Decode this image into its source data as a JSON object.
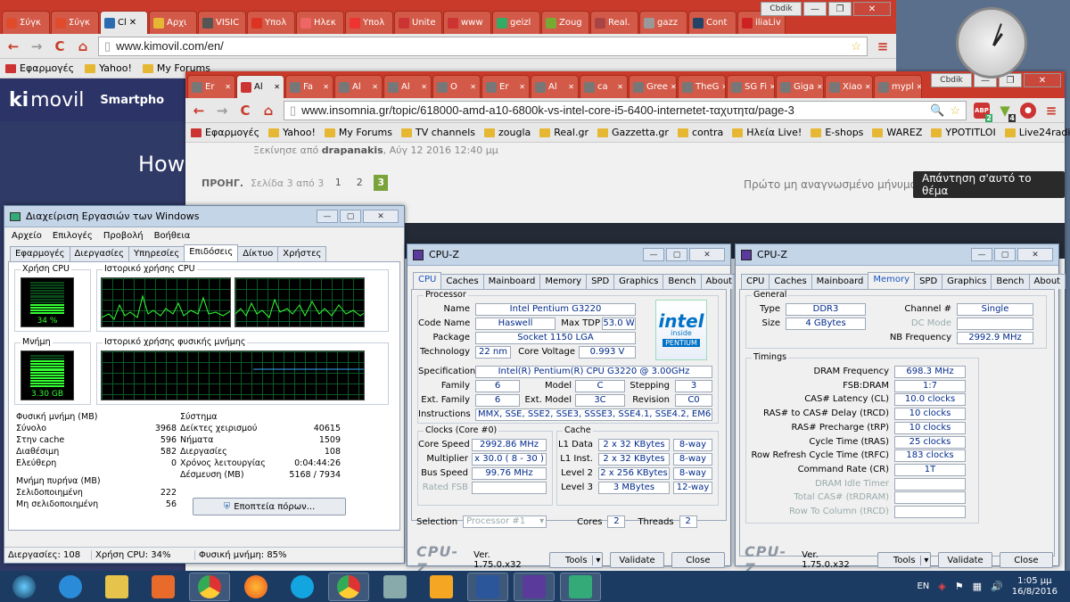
{
  "browser1": {
    "tabs": [
      {
        "label": "Σύγκ",
        "color": "#e04b2c"
      },
      {
        "label": "Σύγκ",
        "color": "#e04b2c"
      },
      {
        "label": "Cl",
        "color": "#2b6cb0",
        "active": true
      },
      {
        "label": "Αρχι",
        "color": "#e6b733"
      },
      {
        "label": "VISIC",
        "color": "#555"
      },
      {
        "label": "Υπολ",
        "color": "#d32"
      },
      {
        "label": "Ηλεκ",
        "color": "#e66"
      },
      {
        "label": "Υπολ",
        "color": "#e33"
      },
      {
        "label": "Unite",
        "color": "#c33"
      },
      {
        "label": "www",
        "color": "#c33"
      },
      {
        "label": "geizl",
        "color": "#3a6"
      },
      {
        "label": "Zoug",
        "color": "#7a3"
      },
      {
        "label": "Real.",
        "color": "#a44"
      },
      {
        "label": "gazz",
        "color": "#999"
      },
      {
        "label": "Cont",
        "color": "#246"
      },
      {
        "label": "iliaLiv",
        "color": "#c22"
      }
    ],
    "url": "www.kimovil.com/en/",
    "user": "Cbdik",
    "bookmarks": [
      "Εφαρμογές",
      "Yahoo!",
      "My Forums"
    ],
    "site_logo": "movil",
    "site_nav": "Smartpho",
    "site_heading": "How"
  },
  "browser2": {
    "tabs": [
      "Er",
      "Al",
      "Fa",
      "Al",
      "Al",
      "O",
      "Er",
      "Al",
      "ca",
      "Gree",
      "TheG",
      "SG Fi",
      "Giga",
      "Xiao",
      "mypl"
    ],
    "url": "www.insomnia.gr/topic/618000-amd-a10-6800k-vs-intel-core-i5-6400-internetet-ταχυτητα/page-3",
    "user": "Cbdik",
    "abp_count": "2",
    "shield_count": "4",
    "bookmarks": [
      "Εφαρμογές",
      "Yahoo!",
      "My Forums",
      "TV channels",
      "zougla",
      "Real.gr",
      "Gazzetta.gr",
      "contra",
      "Ηλεία Live!",
      "E-shops",
      "WAREZ",
      "YPOTITLOI",
      "Live24radio"
    ],
    "started_by_prefix": "Ξεκίνησε από",
    "started_by_user": "drapanakis",
    "started_by_date": ", Αύγ 12 2016 12:40 μμ",
    "prev_label": "ΠΡΟΗΓ.",
    "page_of": "Σελίδα 3 από 3",
    "pages": [
      "1",
      "2",
      "3"
    ],
    "first_unread": "Πρώτο μη αναγνωσμένο μήνυμα",
    "reply_button": "Απάντηση σ'αυτό το θέμα"
  },
  "taskmgr": {
    "title": "Διαχείριση Εργασιών των Windows",
    "menu": [
      "Αρχείο",
      "Επιλογές",
      "Προβολή",
      "Βοήθεια"
    ],
    "tabs": [
      "Εφαρμογές",
      "Διεργασίες",
      "Υπηρεσίες",
      "Επιδόσεις",
      "Δίκτυο",
      "Χρήστες"
    ],
    "active_tab": "Επιδόσεις",
    "cpu_usage_label": "Χρήση CPU",
    "cpu_usage_value": "34 %",
    "cpu_usage_fraction": 0.34,
    "cpu_history_label": "Ιστορικό χρήσης CPU",
    "mem_label": "Μνήμη",
    "mem_value": "3.30 GB",
    "mem_fraction": 0.85,
    "mem_history_label": "Ιστορικό χρήσης φυσικής μνήμης",
    "phys_mem": {
      "title": "Φυσική μνήμη (MB)",
      "rows": [
        [
          "Σύνολο",
          "3968"
        ],
        [
          "Στην cache",
          "596"
        ],
        [
          "Διαθέσιμη",
          "582"
        ],
        [
          "Ελεύθερη",
          "0"
        ]
      ]
    },
    "kernel_mem": {
      "title": "Μνήμη πυρήνα (MB)",
      "rows": [
        [
          "Σελιδοποιημένη",
          "222"
        ],
        [
          "Μη σελιδοποιημένη",
          "56"
        ]
      ]
    },
    "system": {
      "title": "Σύστημα",
      "rows": [
        [
          "Δείκτες χειρισμού",
          "40615"
        ],
        [
          "Νήματα",
          "1509"
        ],
        [
          "Διεργασίες",
          "108"
        ],
        [
          "Χρόνος λειτουργίας",
          "0:04:44:26"
        ],
        [
          "Δέσμευση (MB)",
          "5168 / 7934"
        ]
      ]
    },
    "resource_button": "Εποπτεία πόρων...",
    "status": [
      "Διεργασίες: 108",
      "Χρήση CPU: 34%",
      "Φυσική μνήμη: 85%"
    ]
  },
  "cpuz1": {
    "title": "CPU-Z",
    "tabs": [
      "CPU",
      "Caches",
      "Mainboard",
      "Memory",
      "SPD",
      "Graphics",
      "Bench",
      "About"
    ],
    "active_tab": "CPU",
    "processor_group": "Processor",
    "name_label": "Name",
    "name": "Intel Pentium G3220",
    "codename_label": "Code Name",
    "codename": "Haswell",
    "tdp_label": "Max TDP",
    "tdp": "53.0 W",
    "package_label": "Package",
    "package": "Socket 1150 LGA",
    "tech_label": "Technology",
    "tech": "22 nm",
    "voltage_label": "Core Voltage",
    "voltage": "0.993 V",
    "spec_label": "Specification",
    "spec": "Intel(R) Pentium(R) CPU G3220 @ 3.00GHz",
    "family_label": "Family",
    "family": "6",
    "model_label": "Model",
    "model": "C",
    "stepping_label": "Stepping",
    "stepping": "3",
    "extfamily_label": "Ext. Family",
    "extfamily": "6",
    "extmodel_label": "Ext. Model",
    "extmodel": "3C",
    "revision_label": "Revision",
    "revision": "C0",
    "instr_label": "Instructions",
    "instr": "MMX, SSE, SSE2, SSE3, SSSE3, SSE4.1, SSE4.2, EM64T, VT-x",
    "logo_brand": "intel",
    "logo_sub": "inside",
    "logo_model": "PENTIUM",
    "clocks_group": "Clocks (Core #0)",
    "corespeed_label": "Core Speed",
    "corespeed": "2992.86 MHz",
    "multiplier_label": "Multiplier",
    "multiplier": "x 30.0 ( 8 - 30 )",
    "busspeed_label": "Bus Speed",
    "busspeed": "99.76 MHz",
    "ratedfsb_label": "Rated FSB",
    "cache_group": "Cache",
    "l1d_label": "L1 Data",
    "l1d": "2 x 32 KBytes",
    "l1d_way": "8-way",
    "l1i_label": "L1 Inst.",
    "l1i": "2 x 32 KBytes",
    "l1i_way": "8-way",
    "l2_label": "Level 2",
    "l2": "2 x 256 KBytes",
    "l2_way": "8-way",
    "l3_label": "Level 3",
    "l3": "3 MBytes",
    "l3_way": "12-way",
    "selection_label": "Selection",
    "selection": "Processor #1",
    "cores_label": "Cores",
    "cores": "2",
    "threads_label": "Threads",
    "threads": "2",
    "logo": "CPU-Z",
    "version": "Ver. 1.75.0.x32",
    "tools": "Tools",
    "validate": "Validate",
    "close": "Close"
  },
  "cpuz2": {
    "title": "CPU-Z",
    "tabs": [
      "CPU",
      "Caches",
      "Mainboard",
      "Memory",
      "SPD",
      "Graphics",
      "Bench",
      "About"
    ],
    "active_tab": "Memory",
    "general_group": "General",
    "type_label": "Type",
    "type": "DDR3",
    "channel_label": "Channel #",
    "channel": "Single",
    "size_label": "Size",
    "size": "4 GBytes",
    "dcmode_label": "DC Mode",
    "nbfreq_label": "NB Frequency",
    "nbfreq": "2992.9 MHz",
    "timings_group": "Timings",
    "timings": [
      [
        "DRAM Frequency",
        "698.3 MHz",
        false
      ],
      [
        "FSB:DRAM",
        "1:7",
        false
      ],
      [
        "CAS# Latency (CL)",
        "10.0 clocks",
        false
      ],
      [
        "RAS# to CAS# Delay (tRCD)",
        "10 clocks",
        false
      ],
      [
        "RAS# Precharge (tRP)",
        "10 clocks",
        false
      ],
      [
        "Cycle Time (tRAS)",
        "25 clocks",
        false
      ],
      [
        "Row Refresh Cycle Time (tRFC)",
        "183 clocks",
        false
      ],
      [
        "Command Rate (CR)",
        "1T",
        false
      ],
      [
        "DRAM Idle Timer",
        "",
        true
      ],
      [
        "Total CAS# (tRDRAM)",
        "",
        true
      ],
      [
        "Row To Column (tRCD)",
        "",
        true
      ]
    ],
    "logo": "CPU-Z",
    "version": "Ver. 1.75.0.x32",
    "tools": "Tools",
    "validate": "Validate",
    "close": "Close"
  },
  "tray": {
    "lang": "EN",
    "time": "1:05 μμ",
    "date": "16/8/2016"
  }
}
